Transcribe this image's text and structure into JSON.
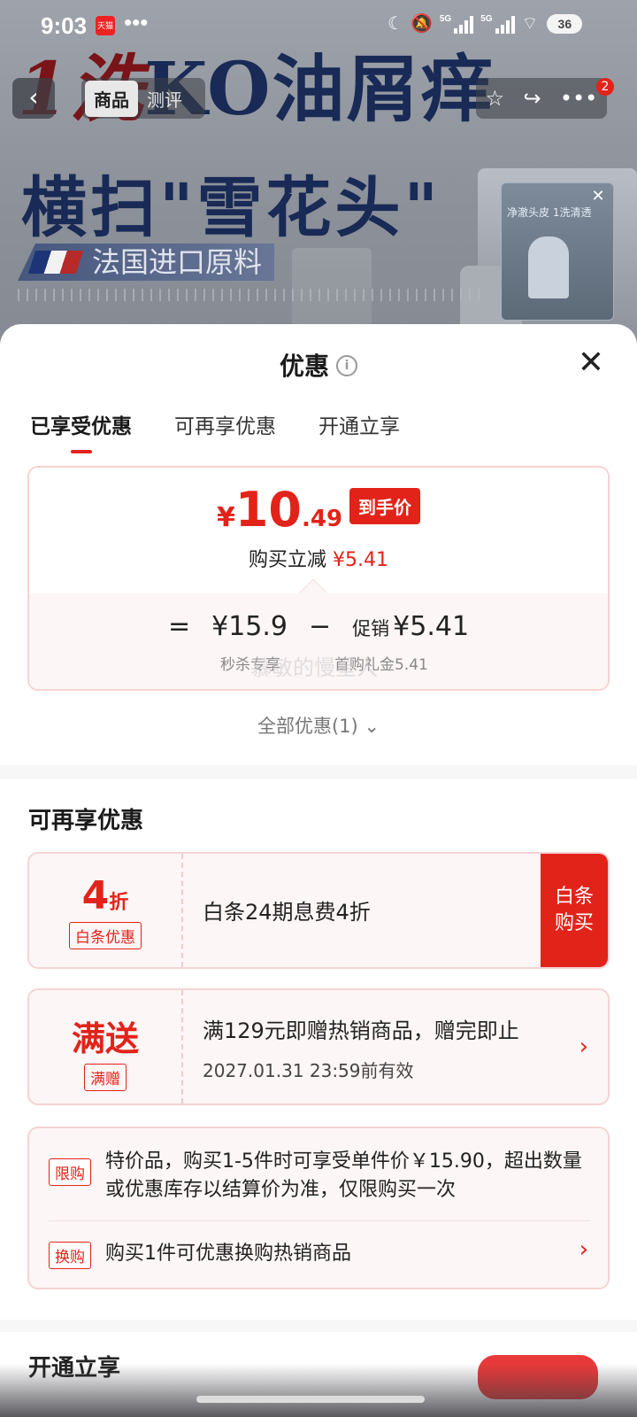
{
  "status_bar": {
    "time": "9:03",
    "app_badge": "天猫",
    "overflow": "•••",
    "signal1": "5G",
    "signal2": "5G",
    "battery": "36"
  },
  "ad_banner": {
    "line1_red": "1洗",
    "line1_blue": "KO油屑痒",
    "line2": "横扫\"雪花头\"",
    "line3": "法国进口原料"
  },
  "top_nav": {
    "back": "‹",
    "tab_product": "商品",
    "tab_review": "测评",
    "cart_badge": "2"
  },
  "video": {
    "caption": "净澈头皮 1洗清透"
  },
  "sheet": {
    "title": "优惠",
    "info": "i",
    "close": "✕",
    "tabs": [
      "已享受优惠",
      "可再享优惠",
      "开通立享"
    ],
    "final_price": {
      "currency": "¥",
      "integer": "10",
      "decimal": ".49",
      "tag": "到手价"
    },
    "reduce_label": "购买立减",
    "reduce_amount": "¥5.41",
    "breakdown": {
      "eq": "=",
      "base": "¥15.9",
      "minus": "−",
      "promo_label": "促销",
      "promo_amount": "¥5.41",
      "base_sub": "秒杀专享",
      "promo_sub": "首购礼金5.41"
    },
    "watermark": "慕敏的慢星人",
    "all_offers": "全部优惠(1)",
    "chevron": "⌄",
    "section_title": "可再享优惠",
    "coupons": [
      {
        "big": "4",
        "big_unit": "折",
        "tag": "白条优惠",
        "text": "白条24期息费4折",
        "action": [
          "白条",
          "购买"
        ]
      },
      {
        "big": "满送",
        "tag": "满赠",
        "text": "满129元即赠热销商品，赠完即止",
        "sub": "2027.01.31 23:59前有效",
        "arrow": "›"
      }
    ],
    "rules": [
      {
        "tag": "限购",
        "text": "特价品，购买1-5件时可享受单件价￥15.90，超出数量或优惠库存以结算价为准，仅限购买一次"
      },
      {
        "tag": "换购",
        "text": "购买1件可优惠换购热销商品",
        "arrow": "›"
      }
    ],
    "peek_title": "开通立享"
  }
}
